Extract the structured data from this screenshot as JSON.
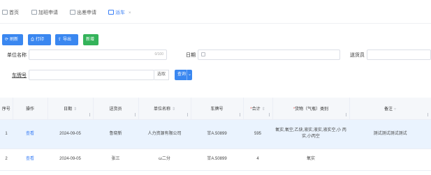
{
  "tabs": [
    {
      "label": "首页"
    },
    {
      "label": "加班申请"
    },
    {
      "label": "出差申请"
    },
    {
      "label": "派车",
      "close": "×"
    }
  ],
  "toolbar": {
    "refresh": "刷新",
    "print": "打印",
    "export": "导出",
    "add": "新增"
  },
  "filters": {
    "unit_label": "单位名称",
    "unit_count": "0/100",
    "date_label": "日期",
    "sender_label": "送货员",
    "plate_label": "车牌号",
    "pick": "选取",
    "query": "查询",
    "query_dropdown": "⌄"
  },
  "table": {
    "headers": {
      "index": "序号",
      "action": "操作",
      "date": "日期",
      "sender": "送货员",
      "unit": "单位名称",
      "plate": "车牌号",
      "total": "合计",
      "goods": "货物（气瓶）类别",
      "remark": "备注"
    },
    "rows": [
      {
        "index": "1",
        "action": "查看",
        "date": "2024-09-05",
        "sender": "鲁晓新",
        "unit": "人力资源有限公司",
        "plate": "甘A.50899",
        "total": "595",
        "goods": "氧实,氧空,乙炔,液实,液实,液实空,小 丙实,小丙空",
        "remark": "测试测试测试测试"
      },
      {
        "index": "2",
        "action": "查看",
        "date": "2024-09-05",
        "sender": "张三",
        "unit": "ω二分",
        "plate": "甘A.50899",
        "total": "4",
        "goods": "氧实",
        "remark": ""
      }
    ]
  }
}
